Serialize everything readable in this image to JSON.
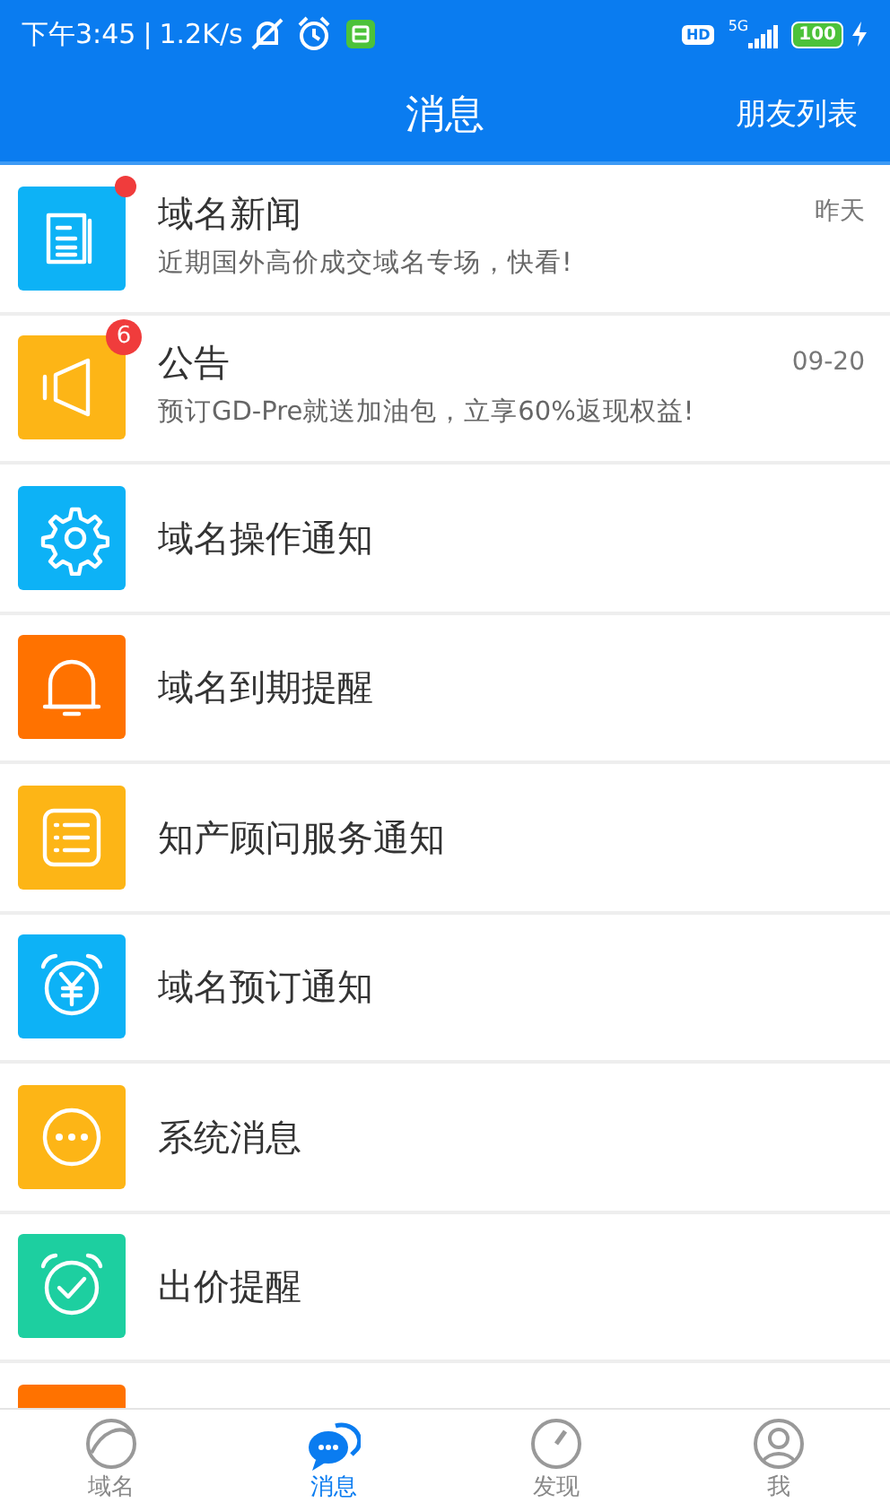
{
  "status_bar": {
    "time": "下午3:45",
    "separator": "|",
    "speed": "1.2K/s",
    "hd": "HD",
    "network": "5G",
    "battery": "100"
  },
  "header": {
    "title": "消息",
    "action": "朋友列表"
  },
  "messages": [
    {
      "kind": "news",
      "color": "#0db2f6",
      "title": "域名新闻",
      "subtitle": "近期国外高价成交域名专场，快看!",
      "time": "昨天",
      "badge": {
        "kind": "dot"
      }
    },
    {
      "kind": "announcement",
      "color": "#fdb516",
      "title": "公告",
      "subtitle": "预订GD-Pre就送加油包，立享60%返现权益!",
      "time": "09-20",
      "badge": {
        "kind": "count",
        "text": "6"
      }
    },
    {
      "kind": "operation",
      "color": "#0db2f6",
      "title": "域名操作通知"
    },
    {
      "kind": "expiry",
      "color": "#ff7200",
      "title": "域名到期提醒"
    },
    {
      "kind": "service",
      "color": "#fdb516",
      "title": "知产顾问服务通知"
    },
    {
      "kind": "reservation",
      "color": "#0db2f6",
      "title": "域名预订通知"
    },
    {
      "kind": "system",
      "color": "#fdb516",
      "title": "系统消息"
    },
    {
      "kind": "bid",
      "color": "#1dcfa0",
      "title": "出价提醒"
    },
    {
      "kind": "guide",
      "color": "#ff7200"
    }
  ],
  "tabs": [
    {
      "kind": "domain",
      "label": "域名",
      "selected": false
    },
    {
      "kind": "messages",
      "label": "消息",
      "selected": true
    },
    {
      "kind": "discover",
      "label": "发现",
      "selected": false
    },
    {
      "kind": "me",
      "label": "我",
      "selected": false
    }
  ]
}
